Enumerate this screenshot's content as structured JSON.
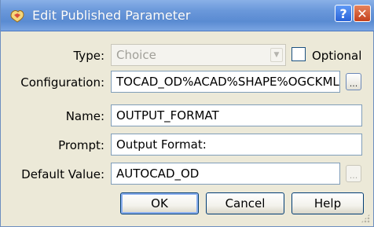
{
  "window": {
    "title": "Edit Published Parameter",
    "help_icon": "question-icon",
    "close_icon": "close-x-icon"
  },
  "form": {
    "type": {
      "label": "Type:",
      "value": "Choice",
      "disabled": true
    },
    "optional": {
      "label": "Optional",
      "checked": false
    },
    "configuration": {
      "label": "Configuration:",
      "value": "TOCAD_OD%ACAD%SHAPE%OGCKML",
      "browse_label": "..."
    },
    "name": {
      "label": "Name:",
      "value": "OUTPUT_FORMAT"
    },
    "prompt": {
      "label": "Prompt:",
      "value": "Output Format:"
    },
    "default_value": {
      "label": "Default Value:",
      "value": "AUTOCAD_OD",
      "browse_label": "..."
    }
  },
  "buttons": {
    "ok": "OK",
    "cancel": "Cancel",
    "help": "Help"
  },
  "colors": {
    "titlebar": "#5a8bd2",
    "dialog_bg": "#ece9d8",
    "field_border": "#7f9db9"
  }
}
